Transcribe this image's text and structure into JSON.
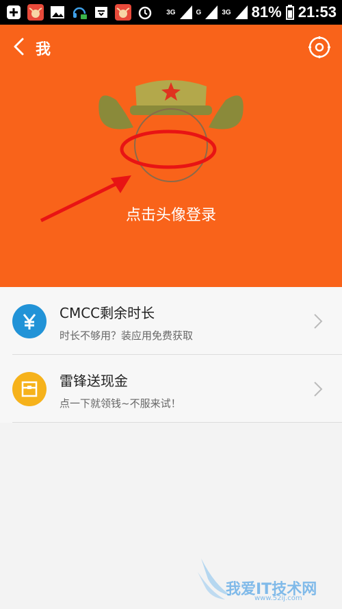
{
  "status_bar": {
    "battery": "81%",
    "time": "21:53",
    "network_a": "3G",
    "network_b": "G",
    "network_c": "3G",
    "icons": [
      "add-icon",
      "app-cow-icon",
      "gallery-icon",
      "headset-icon",
      "inbox-icon",
      "app-cow-icon",
      "alarm-icon"
    ]
  },
  "header": {
    "title": "我",
    "login_prompt": "点击头像登录",
    "background": "#f9631a"
  },
  "list": [
    {
      "title": "CMCC剩余时长",
      "subtitle": "时长不够用？装应用免费获取",
      "icon": "yen-icon",
      "icon_color": "#2293d7"
    },
    {
      "title": "雷锋送现金",
      "subtitle": "点一下就领钱~不服来试！",
      "icon": "envelope-icon",
      "icon_color": "#f6b21b"
    }
  ],
  "watermark": {
    "text": "我爱IT技术网",
    "url": "www.52ij.com"
  }
}
